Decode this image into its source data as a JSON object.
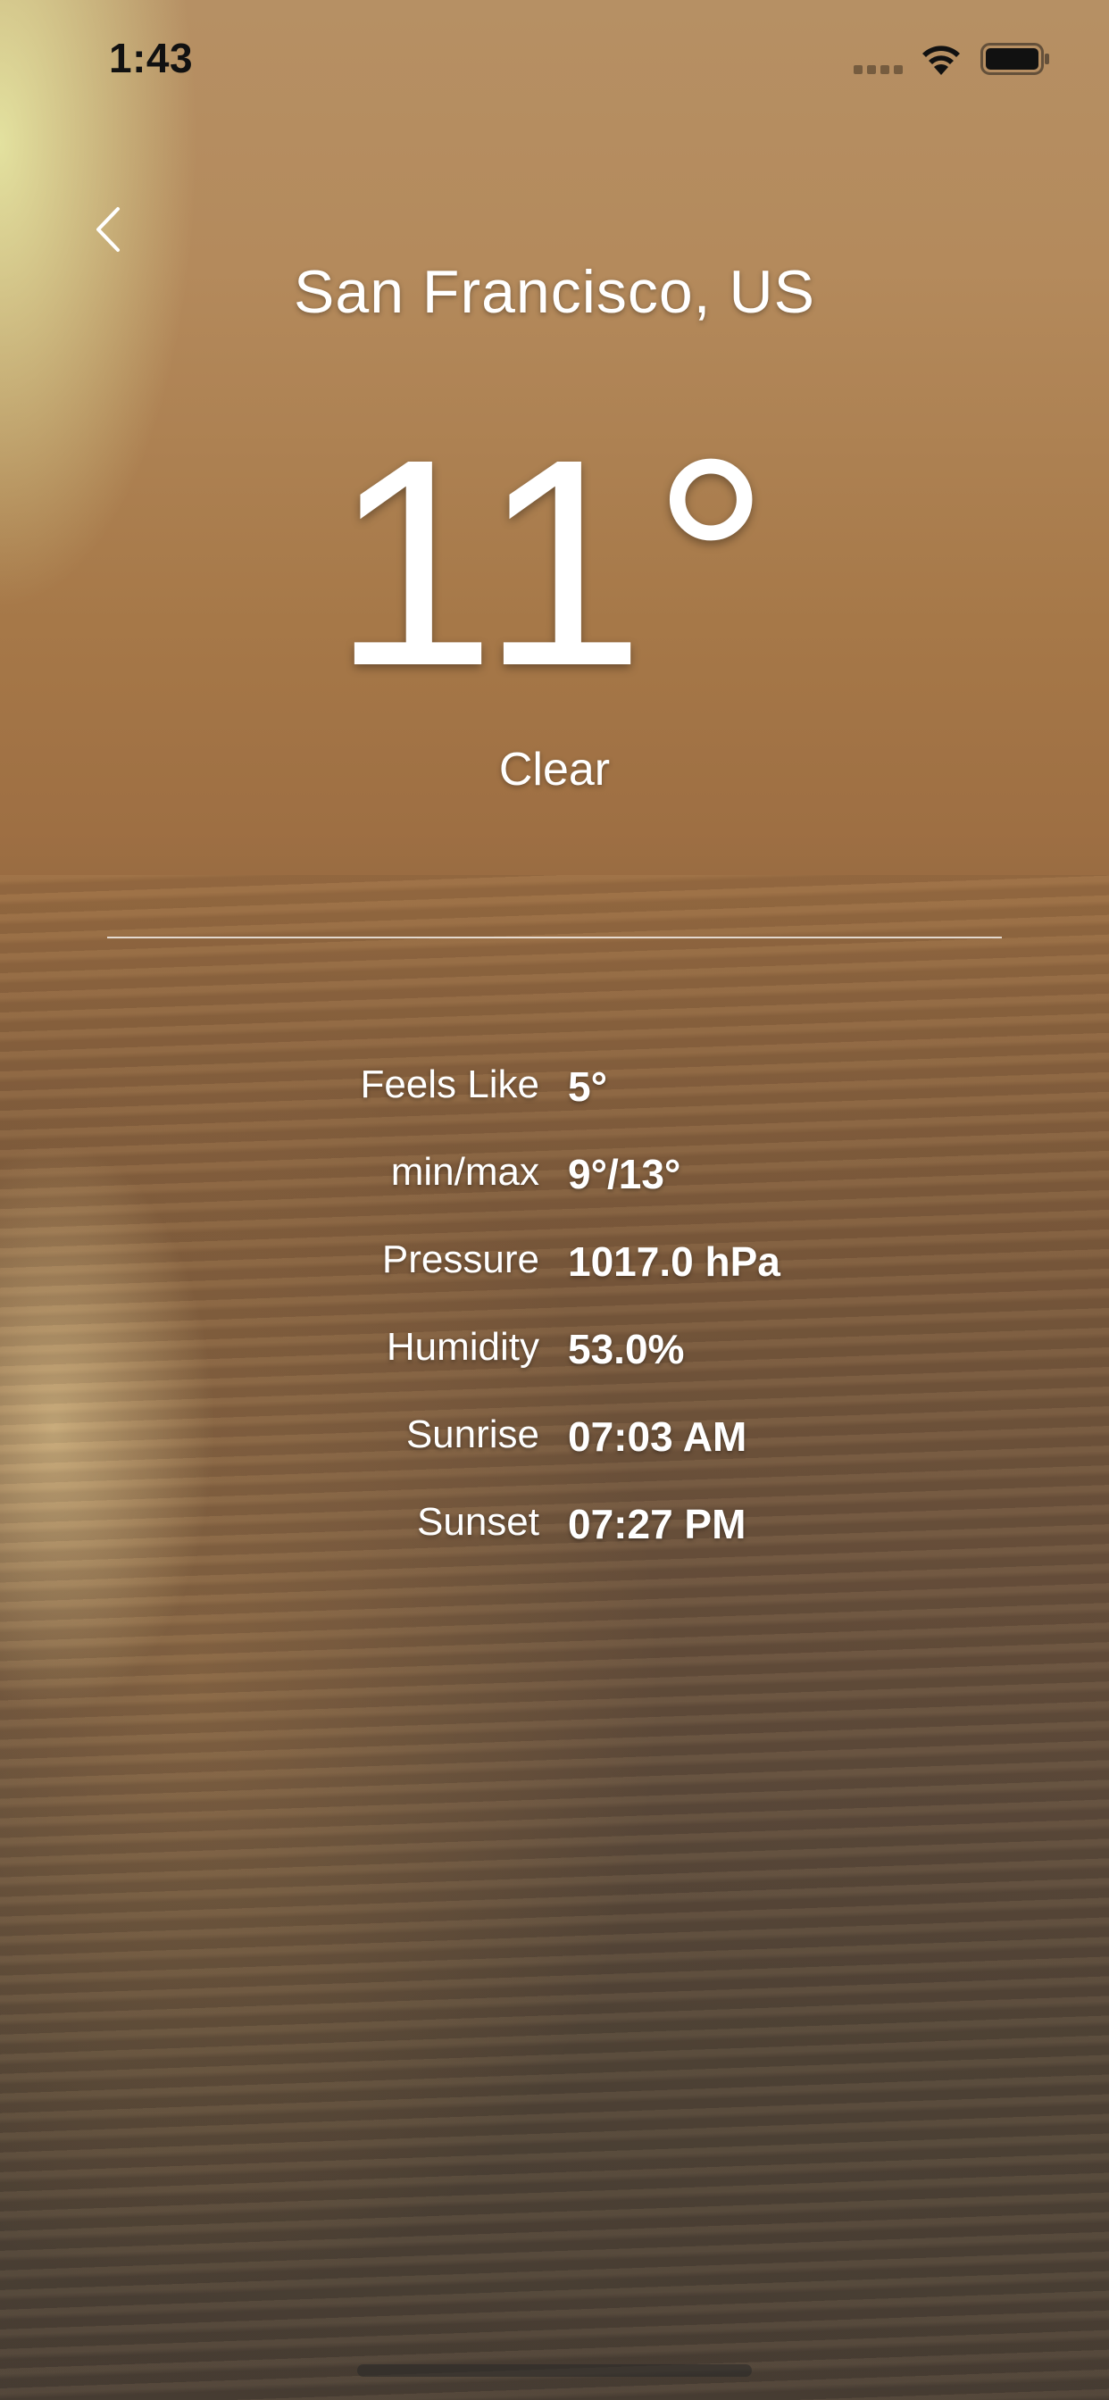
{
  "status_bar": {
    "time": "1:43",
    "icons": [
      "signal-icon",
      "wifi-icon",
      "battery-icon"
    ]
  },
  "header": {
    "back_icon": "chevron-left-icon"
  },
  "weather": {
    "city": "San Francisco, US",
    "temperature": "11°",
    "condition": "Clear"
  },
  "details": [
    {
      "label": "Feels Like",
      "value": "5°"
    },
    {
      "label": "min/max",
      "value": "9°/13°"
    },
    {
      "label": "Pressure",
      "value": "1017.0 hPa"
    },
    {
      "label": "Humidity",
      "value": "53.0%"
    },
    {
      "label": "Sunrise",
      "value": "07:03 AM"
    },
    {
      "label": "Sunset",
      "value": "07:27 PM"
    }
  ],
  "colors": {
    "text": "#ffffff",
    "status_text": "#111111"
  }
}
